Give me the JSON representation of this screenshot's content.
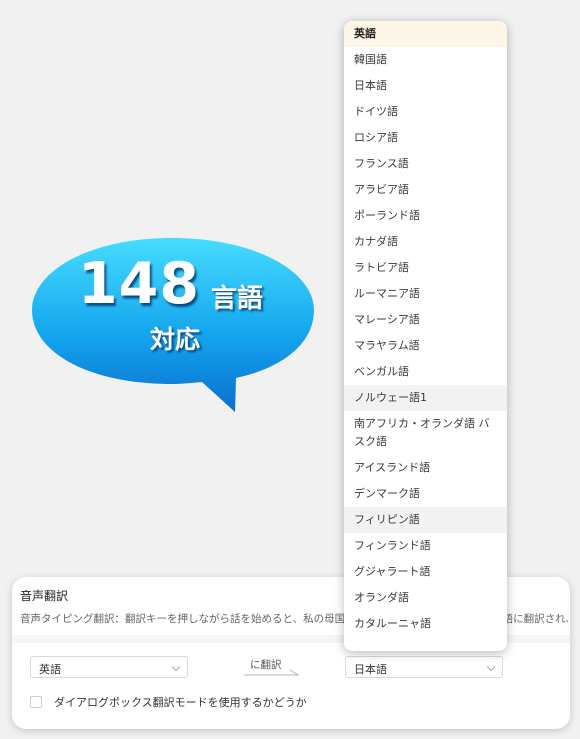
{
  "promo": {
    "count": "148",
    "unit": "言語",
    "support": "対応"
  },
  "language_dropdown": {
    "options": [
      {
        "label": "英語",
        "state": "selected"
      },
      {
        "label": "韓国語",
        "state": ""
      },
      {
        "label": "日本語",
        "state": ""
      },
      {
        "label": "ドイツ語",
        "state": ""
      },
      {
        "label": "ロシア語",
        "state": ""
      },
      {
        "label": "フランス語",
        "state": ""
      },
      {
        "label": "アラビア語",
        "state": ""
      },
      {
        "label": "ポーランド語",
        "state": ""
      },
      {
        "label": "カナダ語",
        "state": ""
      },
      {
        "label": "ラトビア語",
        "state": ""
      },
      {
        "label": "ルーマニア語",
        "state": ""
      },
      {
        "label": "マレーシア語",
        "state": ""
      },
      {
        "label": "マラヤラム語",
        "state": ""
      },
      {
        "label": "ベンガル語",
        "state": ""
      },
      {
        "label": "ノルウェー語1",
        "state": "hover"
      },
      {
        "label": "南アフリカ・オランダ語 バスク語",
        "state": "tall"
      },
      {
        "label": "アイスランド語",
        "state": ""
      },
      {
        "label": "デンマーク語",
        "state": ""
      },
      {
        "label": "フィリピン語",
        "state": "hover"
      },
      {
        "label": "フィンランド語",
        "state": ""
      },
      {
        "label": "グジャラート語",
        "state": ""
      },
      {
        "label": "オランダ語",
        "state": ""
      },
      {
        "label": "カタルーニャ語",
        "state": ""
      }
    ]
  },
  "voice_translation": {
    "title": "音声翻訳",
    "description": "音声タイピング翻訳：翻訳キーを押しながら話を始めると、私の母国語で話した内容が自動的に他の言語に翻訳され、文字入力を実",
    "source_language": "英語",
    "arrow_label": "に翻訳",
    "target_language": "日本語",
    "dialog_mode_label": "ダイアログボックス翻訳モードを使用するかどうか"
  },
  "colors": {
    "bubble_light": "#3fd6ff",
    "bubble_dark": "#0a7fd8",
    "selected_bg": "#fdf5e6",
    "hover_bg": "#f2f2f2"
  }
}
